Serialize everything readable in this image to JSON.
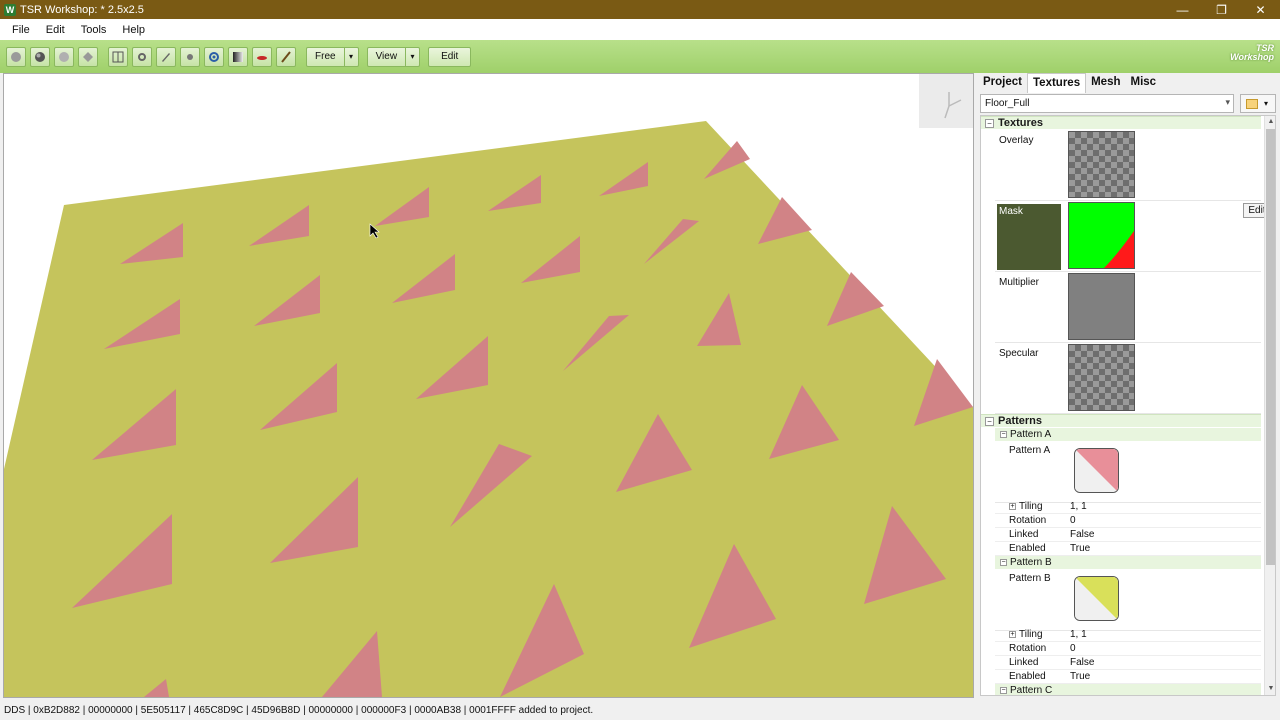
{
  "window": {
    "app_icon": "W",
    "title": "TSR Workshop: * 2.5x2.5",
    "minimize_glyph": "—",
    "restore_glyph": "❐",
    "close_glyph": "✕"
  },
  "menu": [
    "File",
    "Edit",
    "Tools",
    "Help"
  ],
  "toolbar": {
    "icons": [
      "sphere-flat-icon",
      "sphere-shaded-icon",
      "sphere-light-icon",
      "diamond-icon",
      "grid-icon",
      "bone-icon",
      "camera-icon",
      "dot-icon",
      "joint-icon",
      "gradient-icon",
      "lips-icon",
      "brush-icon"
    ],
    "mode_label": "Free",
    "view_label": "View",
    "edit_label": "Edit",
    "dropdown_arrow": "▾",
    "logo_line1": "TSR",
    "logo_line2": "Workshop"
  },
  "viewport": {
    "floor_color": "#c5c45c",
    "pattern_color": "#d18386"
  },
  "panel": {
    "tabs": [
      "Project",
      "Textures",
      "Mesh",
      "Misc"
    ],
    "active_tab": "Textures",
    "preset_value": "Floor_Full",
    "textures_section": "Textures",
    "collapse_glyph": "−",
    "expand_glyph": "+",
    "texture_rows": [
      {
        "label": "Overlay"
      },
      {
        "label": "Mask",
        "edit_label": "Edit"
      },
      {
        "label": "Multiplier"
      },
      {
        "label": "Specular"
      }
    ],
    "patterns_section": "Patterns",
    "pattern_a": {
      "header": "Pattern A",
      "label": "Pattern A",
      "swatch_color": "#e88f99",
      "props": [
        {
          "key": "Tiling",
          "value": "1, 1"
        },
        {
          "key": "Rotation",
          "value": "0"
        },
        {
          "key": "Linked",
          "value": "False"
        },
        {
          "key": "Enabled",
          "value": "True"
        }
      ]
    },
    "pattern_b": {
      "header": "Pattern B",
      "label": "Pattern B",
      "swatch_color": "#d9e05a",
      "props": [
        {
          "key": "Tiling",
          "value": "1, 1"
        },
        {
          "key": "Rotation",
          "value": "0"
        },
        {
          "key": "Linked",
          "value": "False"
        },
        {
          "key": "Enabled",
          "value": "True"
        }
      ]
    },
    "pattern_c": {
      "header": "Pattern C"
    },
    "scroll_up": "▲",
    "scroll_down": "▼"
  },
  "status": {
    "text": "DDS | 0xB2D882 | 00000000 | 5E505117 | 465C8D9C | 45D96B8D | 00000000 | 000000F3 | 0000AB38 | 0001FFFF added to project."
  }
}
